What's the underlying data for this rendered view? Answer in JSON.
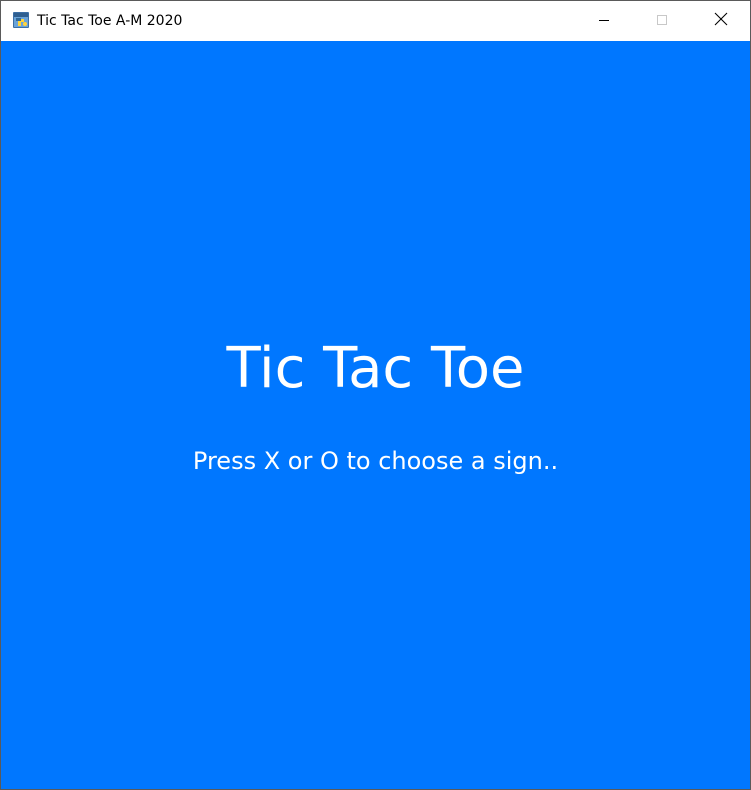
{
  "window": {
    "title": "Tic Tac Toe A-M 2020",
    "icon": "python-app-icon",
    "controls": {
      "minimize_icon": "minimize-icon",
      "maximize_icon": "maximize-icon",
      "close_icon": "close-icon"
    }
  },
  "game": {
    "background_color": "#0077ff",
    "text_color": "#ffffff",
    "title": "Tic Tac Toe",
    "prompt": "Press X or O to choose a sign.."
  }
}
